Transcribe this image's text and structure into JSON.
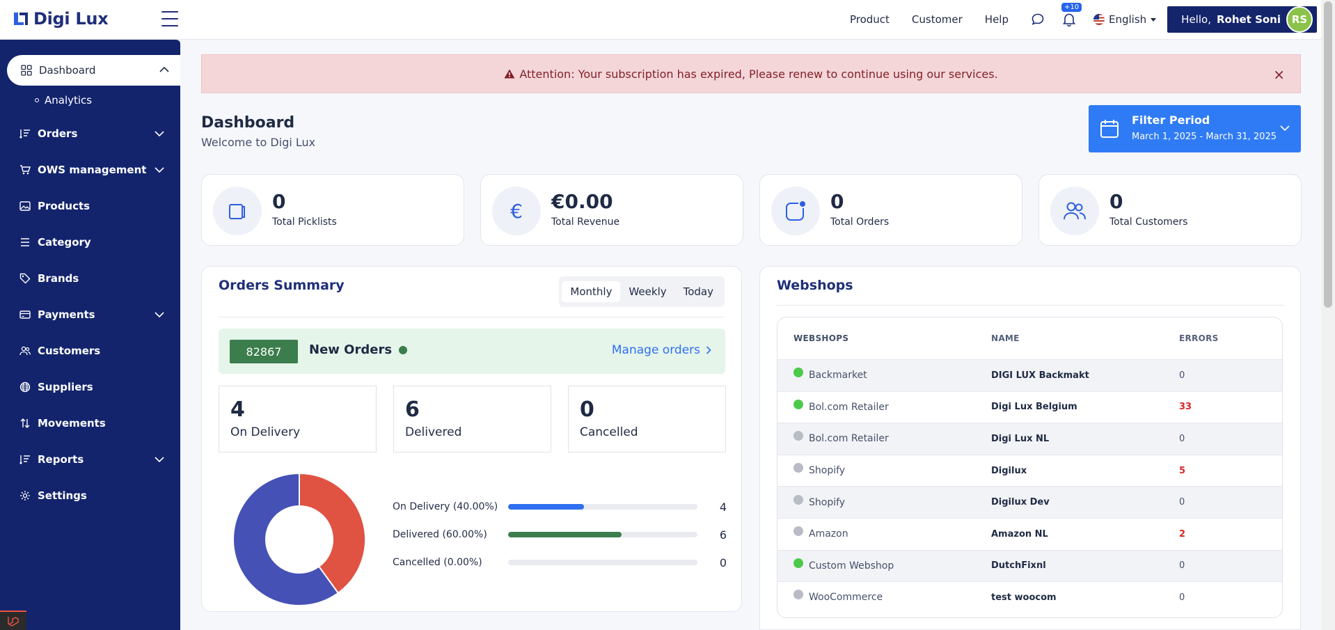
{
  "app": {
    "name": "Digi Lux"
  },
  "topnav": {
    "links": [
      "Product",
      "Customer",
      "Help"
    ],
    "notif_badge": "+10",
    "language": "English",
    "greeting": "Hello,",
    "user_name": "Rohet Soni",
    "user_initials": "RS"
  },
  "sidebar": {
    "active": "Dashboard",
    "sub": "Analytics",
    "items": [
      "Orders",
      "OWS management",
      "Products",
      "Category",
      "Brands",
      "Payments",
      "Customers",
      "Suppliers",
      "Movements",
      "Reports",
      "Settings"
    ]
  },
  "alert": {
    "text": "Attention: Your subscription has expired, Please renew to continue using our services."
  },
  "header": {
    "title": "Dashboard",
    "subtitle": "Welcome to Digi Lux",
    "filter_label": "Filter Period",
    "filter_range": "March 1, 2025 - March 31, 2025"
  },
  "stats": [
    {
      "value": "0",
      "label": "Total Picklists",
      "icon": "picklist-icon"
    },
    {
      "value": "€0.00",
      "label": "Total Revenue",
      "icon": "euro-icon"
    },
    {
      "value": "0",
      "label": "Total Orders",
      "icon": "orders-icon"
    },
    {
      "value": "0",
      "label": "Total Customers",
      "icon": "customers-icon"
    }
  ],
  "orders_summary": {
    "title": "Orders Summary",
    "tabs": [
      "Monthly",
      "Weekly",
      "Today"
    ],
    "active_tab": "Monthly",
    "new_orders_count": "82867",
    "new_orders_label": "New Orders",
    "manage_link": "Manage orders",
    "boxes": [
      {
        "value": "4",
        "label": "On Delivery"
      },
      {
        "value": "6",
        "label": "Delivered"
      },
      {
        "value": "0",
        "label": "Cancelled"
      }
    ],
    "legend": [
      {
        "label": "On Delivery (40.00%)",
        "value": "4",
        "fraction": 0.4,
        "color": "#2f6ff0"
      },
      {
        "label": "Delivered (60.00%)",
        "value": "6",
        "fraction": 0.6,
        "color": "#3b7d4c"
      },
      {
        "label": "Cancelled (0.00%)",
        "value": "0",
        "fraction": 0,
        "color": "#9ca3af"
      }
    ]
  },
  "chart_data": {
    "type": "pie",
    "categories": [
      "On Delivery",
      "Delivered",
      "Cancelled"
    ],
    "values": [
      4,
      6,
      0
    ],
    "colors": [
      "#e05242",
      "#4551b5",
      "#9ca3af"
    ]
  },
  "webshops": {
    "title": "Webshops",
    "columns": [
      "WEBSHOPS",
      "NAME",
      "ERRORS"
    ],
    "rows": [
      {
        "platform": "Backmarket",
        "name": "DIGI LUX Backmakt",
        "errors": "0",
        "status": "green"
      },
      {
        "platform": "Bol.com Retailer",
        "name": "Digi Lux Belgium",
        "errors": "33",
        "status": "green"
      },
      {
        "platform": "Bol.com Retailer",
        "name": "Digi Lux NL",
        "errors": "0",
        "status": "grey"
      },
      {
        "platform": "Shopify",
        "name": "Digilux",
        "errors": "5",
        "status": "grey"
      },
      {
        "platform": "Shopify",
        "name": "Digilux Dev",
        "errors": "0",
        "status": "grey"
      },
      {
        "platform": "Amazon",
        "name": "Amazon NL",
        "errors": "2",
        "status": "grey"
      },
      {
        "platform": "Custom Webshop",
        "name": "DutchFixnl",
        "errors": "0",
        "status": "green"
      },
      {
        "platform": "WooCommerce",
        "name": "test woocom",
        "errors": "0",
        "status": "grey"
      }
    ]
  }
}
